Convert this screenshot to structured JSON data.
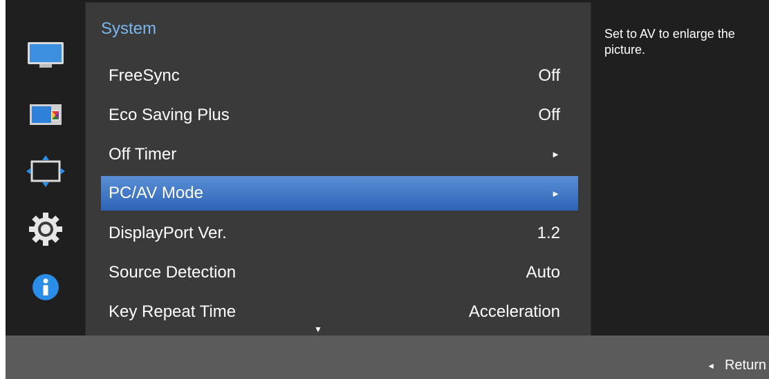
{
  "colors": {
    "background": "#1f1f1f",
    "panel": "#3a3a3a",
    "title": "#79b7ee",
    "highlight": "#3b72c2",
    "bottom_bar": "#5b5b5b"
  },
  "sidebar": {
    "icons": [
      {
        "name": "picture-icon"
      },
      {
        "name": "color-icon"
      },
      {
        "name": "size-position-icon"
      },
      {
        "name": "system-settings-icon"
      },
      {
        "name": "information-icon"
      }
    ]
  },
  "panel": {
    "title": "System",
    "items": [
      {
        "label": "FreeSync",
        "value": "Off"
      },
      {
        "label": "Eco Saving Plus",
        "value": "Off"
      },
      {
        "label": "Off Timer",
        "value": "►"
      },
      {
        "label": "PC/AV Mode",
        "value": "►",
        "selected": true
      },
      {
        "label": "DisplayPort Ver.",
        "value": "1.2"
      },
      {
        "label": "Source Detection",
        "value": "Auto"
      },
      {
        "label": "Key Repeat Time",
        "value": "Acceleration"
      }
    ],
    "more_indicator": "▼"
  },
  "help_text": "Set to AV to enlarge the picture.",
  "footer": {
    "return_arrow": "◄",
    "return_label": "Return"
  }
}
